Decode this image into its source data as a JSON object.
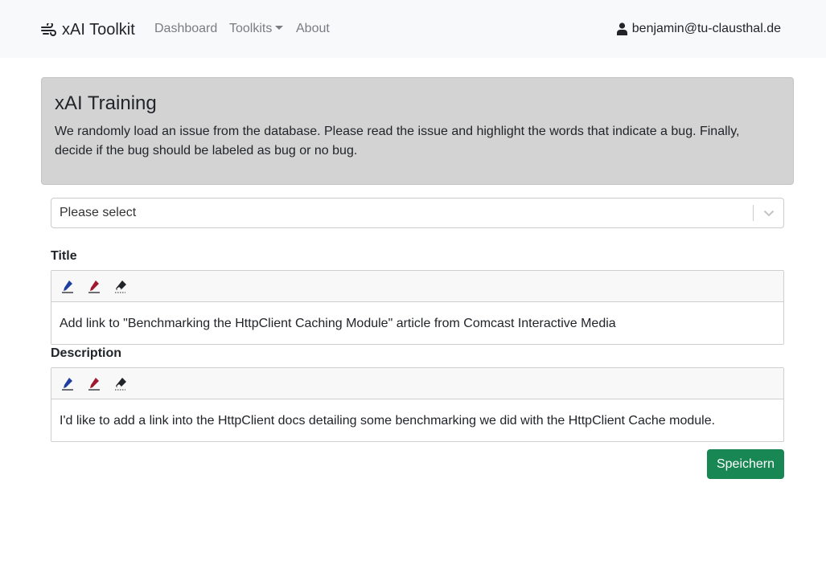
{
  "navbar": {
    "brand": "xAI Toolkit",
    "links": {
      "dashboard": "Dashboard",
      "toolkits": "Toolkits",
      "about": "About"
    },
    "user_email": "benjamin@tu-clausthal.de"
  },
  "jumbotron": {
    "title": "xAI Training",
    "text": "We randomly load an issue from the database. Please read the issue and highlight the words that indicate a bug. Finally, decide if the bug should be labeled as bug or no bug."
  },
  "select": {
    "value": "Please select"
  },
  "issue": {
    "title_label": "Title",
    "title_text": "Add link to \"Benchmarking the HttpClient Caching Module\" article from Comcast Interactive Media",
    "description_label": "Description",
    "description_text": "I'd like to add a link into the HttpClient docs detailing some benchmarking we did with the HttpClient Cache module."
  },
  "tools": [
    "blue-marker-icon",
    "red-marker-icon",
    "eraser-icon"
  ],
  "colors": {
    "marker_blue": "#1f3fa0",
    "marker_red": "#a0182e",
    "save_button": "#198754",
    "jumbotron_bg": "#d3d3d3"
  },
  "actions": {
    "save_label": "Speichern"
  }
}
